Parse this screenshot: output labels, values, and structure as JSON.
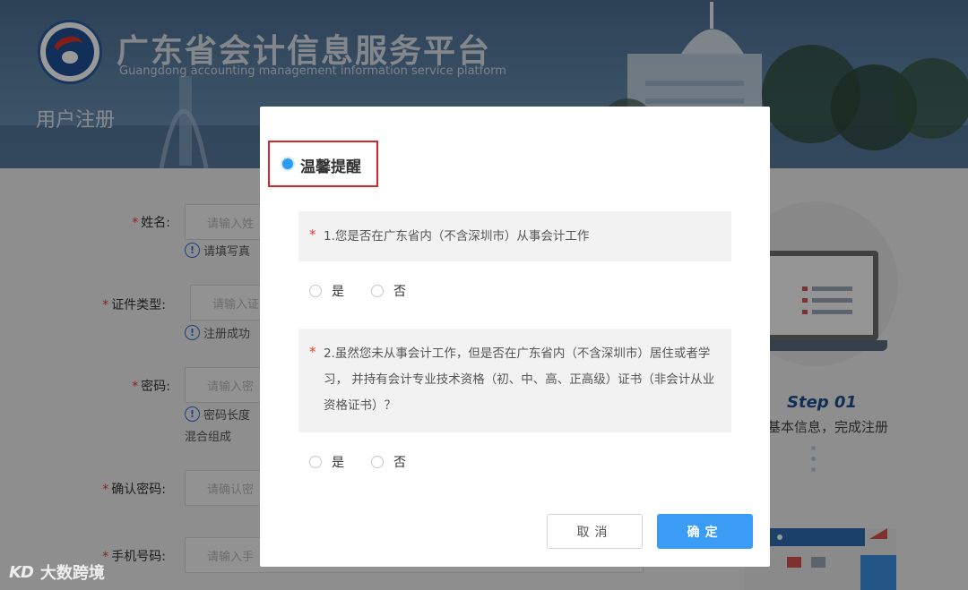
{
  "header": {
    "site_title": "广东省会计信息服务平台",
    "site_subtitle": "Guangdong accounting management information service platform",
    "page_heading": "用户注册"
  },
  "form": {
    "required_mark": "*",
    "name": {
      "label": "姓名:",
      "placeholder": "请输入姓",
      "hint": "请填写真"
    },
    "id_type": {
      "label": "证件类型:",
      "placeholder": "请输入证",
      "hint": "注册成功"
    },
    "password": {
      "label": "密码:",
      "placeholder": "请输入密",
      "hint": "密码长度",
      "hint_line2": "混合组成"
    },
    "confirm_password": {
      "label": "确认密码:",
      "placeholder": "请确认密"
    },
    "phone": {
      "label": "手机号码:",
      "placeholder": "请输入手"
    }
  },
  "illustration": {
    "step_label": "Step 01",
    "step_desc": "基本信息，完成注册"
  },
  "modal": {
    "title": "温馨提醒",
    "required_mark": "*",
    "questions": [
      {
        "text": "1.您是否在广东省内（不含深圳市）从事会计工作",
        "yes": "是",
        "no": "否"
      },
      {
        "text": "2.虽然您未从事会计工作，但是否在广东省内（不含深圳市）居住或者学习， 并持有会计专业技术资格（初、中、高、正高级）证书（非会计从业资格证书）？",
        "yes": "是",
        "no": "否"
      }
    ],
    "cancel_label": "取消",
    "ok_label": "确定"
  },
  "watermark": {
    "logo": "KD",
    "text": "大数跨境"
  }
}
